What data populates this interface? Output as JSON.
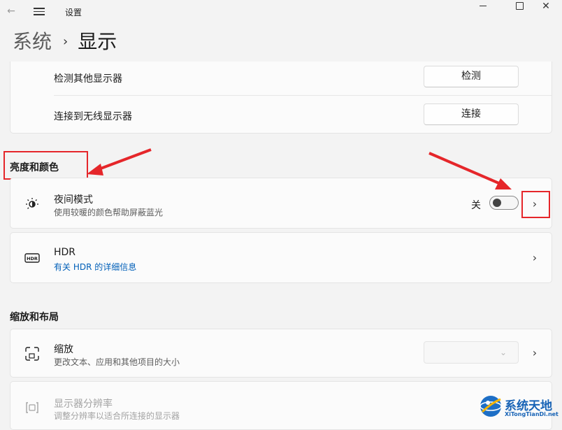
{
  "window": {
    "title": "设置"
  },
  "breadcrumb": {
    "parent": "系统",
    "separator": "›",
    "current": "显示"
  },
  "top_card": {
    "rows": [
      {
        "label": "检测其他显示器",
        "button": "检测"
      },
      {
        "label": "连接到无线显示器",
        "button": "连接"
      }
    ]
  },
  "brightness_section": {
    "title": "亮度和颜色",
    "night_mode": {
      "label": "夜间模式",
      "sub": "使用较暖的颜色帮助屏蔽蓝光",
      "state_text": "关",
      "toggle_on": false,
      "icon": "night-light-icon"
    },
    "hdr": {
      "label": "HDR",
      "link": "有关 HDR 的详细信息",
      "icon": "hdr-icon"
    }
  },
  "scale_section": {
    "title": "缩放和布局",
    "scale": {
      "label": "缩放",
      "sub": "更改文本、应用和其他项目的大小",
      "icon": "scale-icon"
    },
    "resolution": {
      "label": "显示器分辨率",
      "sub": "调整分辨率以适合所连接的显示器",
      "icon": "resolution-icon"
    }
  },
  "watermark": {
    "text": "系统天地",
    "sub": "XiTongTianDi.net"
  },
  "colors": {
    "annotation_red": "#e5262a",
    "link_blue": "#005fb8",
    "watermark_blue": "#1763b6"
  }
}
